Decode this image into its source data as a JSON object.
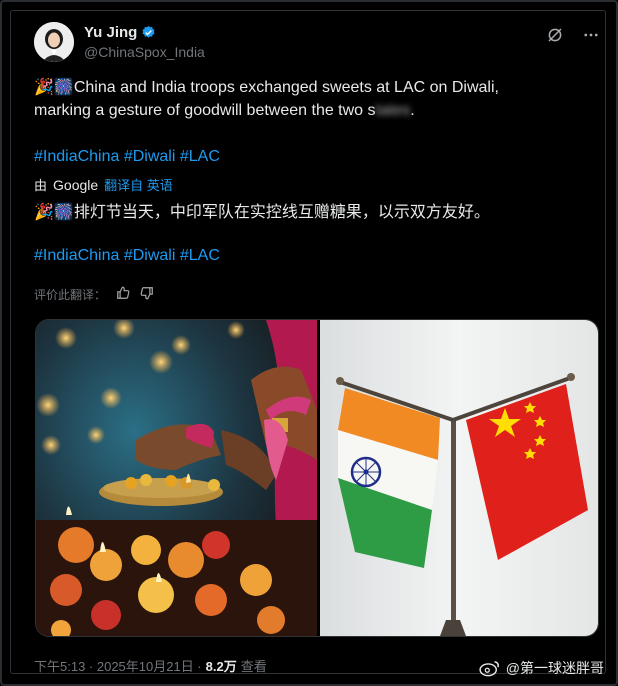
{
  "author": {
    "name": "Yu Jing",
    "handle": "@ChinaSpox_India",
    "avatar_icon": "person-avatar",
    "verified_icon": "verified-badge-icon"
  },
  "header_icons": [
    "grok-icon",
    "more-icon"
  ],
  "tweet": {
    "emoji": "🎉🎆",
    "text_line1": "China and India troops exchanged sweets at LAC on Diwali,",
    "text_line2": "marking a gesture of goodwill between the two s",
    "hashtags": "#IndiaChina #Diwali #LAC"
  },
  "translation": {
    "by": "由",
    "google": "Google",
    "translated_from": "翻译自 英语",
    "emoji": "🎉🎆",
    "text": "排灯节当天，中印军队在实控线互赠糖果，以示双方友好。",
    "hashtags": "#IndiaChina #Diwali #LAC",
    "rate_label": "评价此翻译："
  },
  "footer": {
    "time": "下午5:13 · 2025年10月21日 · ",
    "views_num": "8.2万",
    "views_label": " 查看"
  },
  "watermark": "@第一球迷胖哥",
  "colors": {
    "background": "#000000",
    "link": "#1d9bf0",
    "muted": "#71767b",
    "text": "#e7e9ea",
    "india_saffron": "#f28a24",
    "india_green": "#2e9b45",
    "china_red": "#e0201b",
    "china_yellow": "#ffde00"
  }
}
